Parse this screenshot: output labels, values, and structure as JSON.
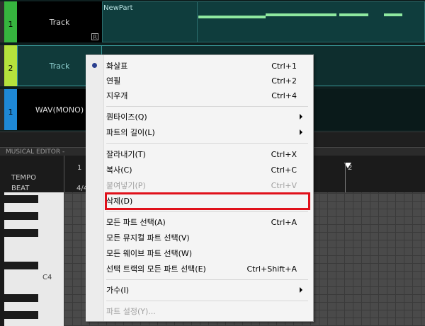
{
  "tracks": [
    {
      "number": "1",
      "name": "Track",
      "num_color": "#36b43e",
      "r_badge": "R"
    },
    {
      "number": "2",
      "name": "Track",
      "num_color": "#b6e23c"
    },
    {
      "number": "1",
      "name": "WAV(MONO)",
      "num_color": "#1e88d6"
    }
  ],
  "part": {
    "name": "NewPart"
  },
  "musical_editor": {
    "title": "MUSICAL EDITOR -",
    "tempo_label": "TEMPO",
    "beat_label": "BEAT",
    "beat_value": "4/4",
    "bar1": "1",
    "bar2": "2",
    "key_label": "C4"
  },
  "menu": {
    "items": [
      {
        "label": "화살표",
        "shortcut": "Ctrl+1",
        "checked": true
      },
      {
        "label": "연필",
        "shortcut": "Ctrl+2"
      },
      {
        "label": "지우개",
        "shortcut": "Ctrl+4"
      },
      {
        "label": "퀀타이즈(Q)",
        "submenu": true
      },
      {
        "label": "파트의 길이(L)",
        "submenu": true
      },
      {
        "label": "잘라내기(T)",
        "shortcut": "Ctrl+X"
      },
      {
        "label": "복사(C)",
        "shortcut": "Ctrl+C"
      },
      {
        "label": "붙여넣기(P)",
        "shortcut": "Ctrl+V",
        "disabled": true
      },
      {
        "label": "삭제(D)",
        "highlighted": true
      },
      {
        "label": "모든 파트 선택(A)",
        "shortcut": "Ctrl+A"
      },
      {
        "label": "모든 뮤지컬 파트 선택(V)"
      },
      {
        "label": "모든 웨이브 파트 선택(W)"
      },
      {
        "label": "선택 트랙의 모든 파트 선택(E)",
        "shortcut": "Ctrl+Shift+A"
      },
      {
        "label": "가수(I)",
        "submenu": true
      },
      {
        "label": "파트 설정(Y)...",
        "disabled": true
      }
    ]
  },
  "colors": {
    "highlight_border": "#e0101a",
    "note": "#8ee8a0"
  }
}
